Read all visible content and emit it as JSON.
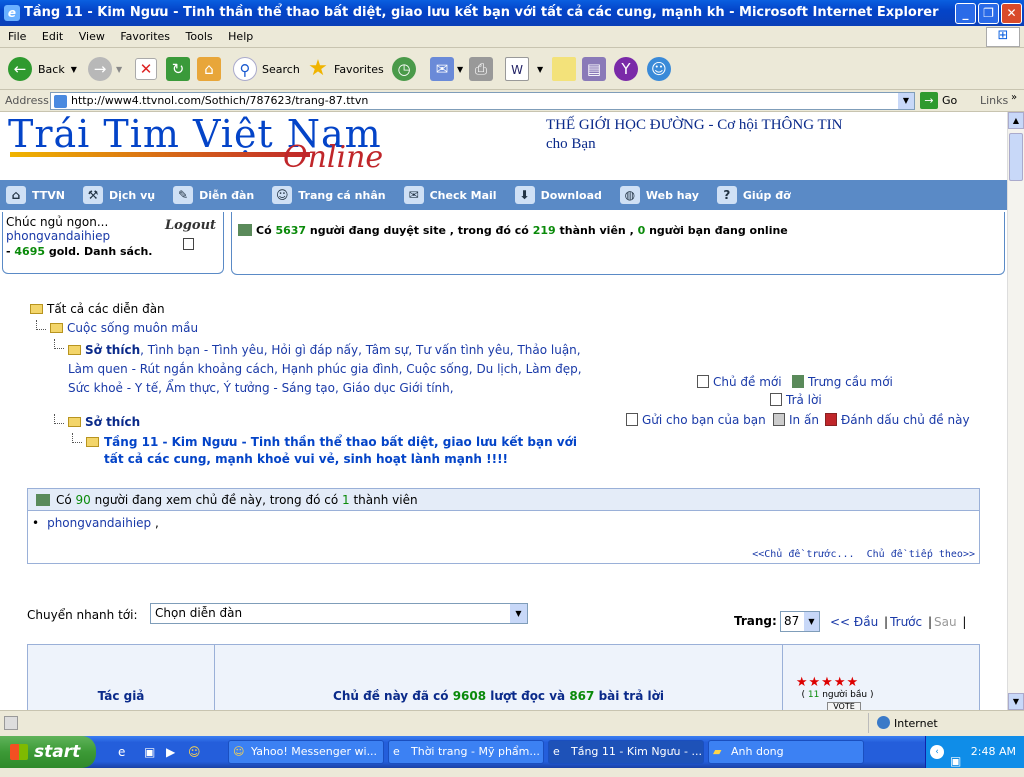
{
  "window": {
    "title": "Tầng 11 - Kim Ngưu - Tinh thần thể thao bất diệt, giao lưu kết bạn với tất cả các cung, mạnh kh - Microsoft Internet Explorer"
  },
  "menu": [
    "File",
    "Edit",
    "View",
    "Favorites",
    "Tools",
    "Help"
  ],
  "toolbar": {
    "back": "Back",
    "search": "Search",
    "favorites": "Favorites"
  },
  "address": {
    "label": "Address",
    "url": "http://www4.ttvnol.com/Sothich/787623/trang-87.ttvn",
    "go": "Go",
    "links": "Links"
  },
  "site": {
    "logo_main": "Trái Tim Việt Nam",
    "logo_sub": "Online",
    "promo": "THẾ GIỚI HỌC ĐƯỜNG - Cơ hội THÔNG TIN cho Bạn"
  },
  "nav": [
    "TTVN",
    "Dịch vụ",
    "Diễn đàn",
    "Trang cá nhân",
    "Check Mail",
    "Download",
    "Web hay",
    "Giúp đỡ"
  ],
  "user": {
    "greeting": "Chúc ngủ ngon...",
    "name": "phongvandaihiep",
    "gold_prefix": "- ",
    "gold": "4695",
    "gold_suffix": " gold. Danh sách.",
    "logout": "Logout"
  },
  "online": {
    "p1": "Có ",
    "total": "5637",
    "p2": " người đang duyệt site , trong đó có ",
    "members": "219",
    "p3": " thành viên , ",
    "friends": "0",
    "p4": " người bạn đang online"
  },
  "breadcrumb": {
    "all": "Tất cả các diễn đàn",
    "cat": "Cuộc sống muôn mầu",
    "sub_title": "Sở thích",
    "sub_list": ", Tình bạn - Tình yêu, Hỏi gì đáp nấy, Tâm sự, Tư vấn tình yêu, Thảo luận, Làm quen - Rút ngắn khoảng cách, Hạnh phúc gia đình, Cuộc sống, Du lịch, Làm đẹp, Sức khoẻ - Y tế, Ẩm thực, Ý tưởng - Sáng tạo, Giáo dục Giới tính,",
    "forum": "Sở thích",
    "topic": "Tầng 11 - Kim Ngưu - Tinh thần thể thao bất diệt, giao lưu kết bạn với tất cả các cung, mạnh khoẻ vui vẻ, sinh hoạt lành mạnh !!!!"
  },
  "actions": {
    "new_topic": "Chủ đề mới",
    "new_poll": "Trưng cầu mới",
    "reply": "Trả lời",
    "send": "Gửi cho bạn của bạn",
    "print": "In ấn",
    "bookmark": "Đánh dấu chủ đề này"
  },
  "viewers": {
    "p1": "Có ",
    "count": "90",
    "p2": " người đang xem chủ đề này, trong đó có ",
    "members": "1",
    "p3": " thành viên",
    "user": "phongvandaihiep",
    "sep": " ,",
    "prev": "<<Chủ đề trước...",
    "next": "Chủ đề tiếp theo>>"
  },
  "quickjump": {
    "label": "Chuyển nhanh tới:",
    "value": "Chọn diễn đàn"
  },
  "paging": {
    "label": "Trang:",
    "current": "87",
    "first": "<< Đầu",
    "prev": "Trước",
    "next": "Sau"
  },
  "table": {
    "author_header": "Tác giả",
    "stats_p1": "Chủ đề này đã có ",
    "reads": "9608",
    "stats_p2": " lượt đọc và ",
    "replies": "867",
    "stats_p3": " bài trả lời",
    "stars": "★★★★★",
    "votes_p1": "( ",
    "votes": "11",
    "votes_p2": " người bầu )",
    "vote_btn": "VOTE"
  },
  "status": {
    "zone": "Internet"
  },
  "taskbar": {
    "start": "start",
    "tasks": [
      "Yahoo! Messenger wi...",
      "Thời trang - Mỹ phẩm...",
      "Tầng 11 - Kim Ngưu - ...",
      "Anh dong"
    ],
    "clock": "2:48 AM"
  },
  "colors": {
    "nav_bg": "#5a8ac6",
    "link": "#1a3aa8",
    "count_green": "#0a8a0a",
    "title_blue": "#0444c8",
    "logo_red": "#c0262a"
  }
}
